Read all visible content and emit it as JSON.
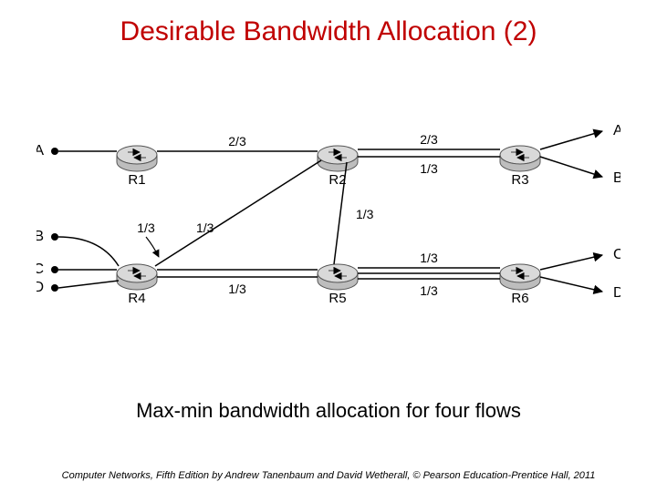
{
  "title": "Desirable Bandwidth Allocation (2)",
  "caption": "Max-min bandwidth allocation for four flows",
  "footer": "Computer Networks, Fifth Edition by Andrew Tanenbaum and David Wetherall, © Pearson Education-Prentice Hall, 2011",
  "endpoints": {
    "A": "A",
    "B": "B",
    "C": "C",
    "D": "D"
  },
  "routers": {
    "R1": "R1",
    "R2": "R2",
    "R3": "R3",
    "R4": "R4",
    "R5": "R5",
    "R6": "R6"
  },
  "bw": {
    "r1r2": "2/3",
    "r2r3_top": "2/3",
    "r2r3_bottom": "1/3",
    "b_r4": "1/3",
    "r4_r2": "1/3",
    "r2_r5": "1/3",
    "r4r5": "1/3",
    "r5r6_top": "1/3",
    "r5r6_bottom": "1/3"
  },
  "chart_data": {
    "type": "table",
    "title": "Max-min bandwidth allocation for four flows",
    "flows": [
      {
        "name": "A",
        "path": [
          "A-left",
          "R1",
          "R2",
          "R3",
          "A-right"
        ],
        "bandwidth": "2/3"
      },
      {
        "name": "B",
        "path": [
          "B-left",
          "R4",
          "R2",
          "R3",
          "B-right"
        ],
        "bandwidth": "1/3"
      },
      {
        "name": "C",
        "path": [
          "C-left",
          "R4",
          "R5",
          "R6",
          "C-right"
        ],
        "bandwidth": "1/3"
      },
      {
        "name": "D",
        "path": [
          "D-left",
          "R4",
          "R5",
          "R6",
          "D-right"
        ],
        "bandwidth": "1/3"
      }
    ],
    "link_allocations": [
      {
        "link": "R1-R2",
        "value": "2/3"
      },
      {
        "link": "R2-R3",
        "values": [
          "2/3",
          "1/3"
        ]
      },
      {
        "link": "B→R4",
        "value": "1/3"
      },
      {
        "link": "R4→R2",
        "value": "1/3"
      },
      {
        "link": "R2→R5",
        "value": "1/3"
      },
      {
        "link": "R4-R5",
        "value": "1/3"
      },
      {
        "link": "R5-R6",
        "values": [
          "1/3",
          "1/3"
        ]
      }
    ]
  }
}
